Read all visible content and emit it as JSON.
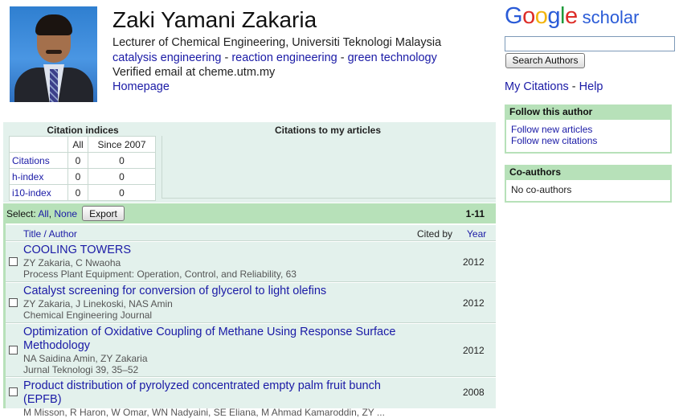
{
  "profile": {
    "name": "Zaki Yamani Zakaria",
    "affiliation": "Lecturer of Chemical Engineering, Universiti Teknologi Malaysia",
    "interests": [
      "catalysis engineering",
      "reaction engineering",
      "green technology"
    ],
    "interest_separator": " - ",
    "email": "Verified email at cheme.utm.my",
    "homepage": "Homepage"
  },
  "logo": {
    "g1": "G",
    "o1": "o",
    "o2": "o",
    "g2": "g",
    "l": "l",
    "e": "e",
    "scholar": "scholar"
  },
  "search": {
    "button": "Search Authors",
    "value": ""
  },
  "links": {
    "my_citations": "My Citations",
    "sep": " - ",
    "help": "Help"
  },
  "follow": {
    "heading": "Follow this author",
    "new_articles": "Follow new articles",
    "new_citations": "Follow new citations"
  },
  "coauthors": {
    "heading": "Co-authors",
    "text": "No co-authors"
  },
  "citation_indices": {
    "heading": "Citation indices",
    "col_all": "All",
    "col_since": "Since 2007",
    "rows": [
      {
        "label": "Citations",
        "all": "0",
        "since": "0"
      },
      {
        "label": "h-index",
        "all": "0",
        "since": "0"
      },
      {
        "label": "i10-index",
        "all": "0",
        "since": "0"
      }
    ]
  },
  "citations_chart": {
    "heading": "Citations to my articles"
  },
  "articles_bar": {
    "select": "Select:",
    "all": "All",
    "sep": ", ",
    "none": "None",
    "export": "Export",
    "count": "1-11"
  },
  "columns": {
    "title": "Title / Author",
    "cited_by": "Cited by",
    "year": "Year"
  },
  "articles": [
    {
      "title": "COOLING TOWERS",
      "authors": "ZY Zakaria, C Nwaoha",
      "venue": "Process Plant Equipment: Operation, Control, and Reliability, 63",
      "year": "2012"
    },
    {
      "title": "Catalyst screening for conversion of glycerol to light olefins",
      "authors": "ZY Zakaria, J Linekoski, NAS Amin",
      "venue": "Chemical Engineering Journal",
      "year": "2012"
    },
    {
      "title": "Optimization of Oxidative Coupling of Methane Using Response Surface Methodology",
      "authors": "NA Saidina Amin, ZY Zakaria",
      "venue": "Jurnal Teknologi 39, 35–52",
      "year": "2012"
    },
    {
      "title": "Product distribution of pyrolyzed concentrated empty palm fruit bunch (EPFB)",
      "authors": "M Misson, R Haron, W Omar, WN Nadyaini, SE Eliana, M Ahmad Kamaroddin, ZY ...",
      "venue": "",
      "year": "2008"
    }
  ]
}
